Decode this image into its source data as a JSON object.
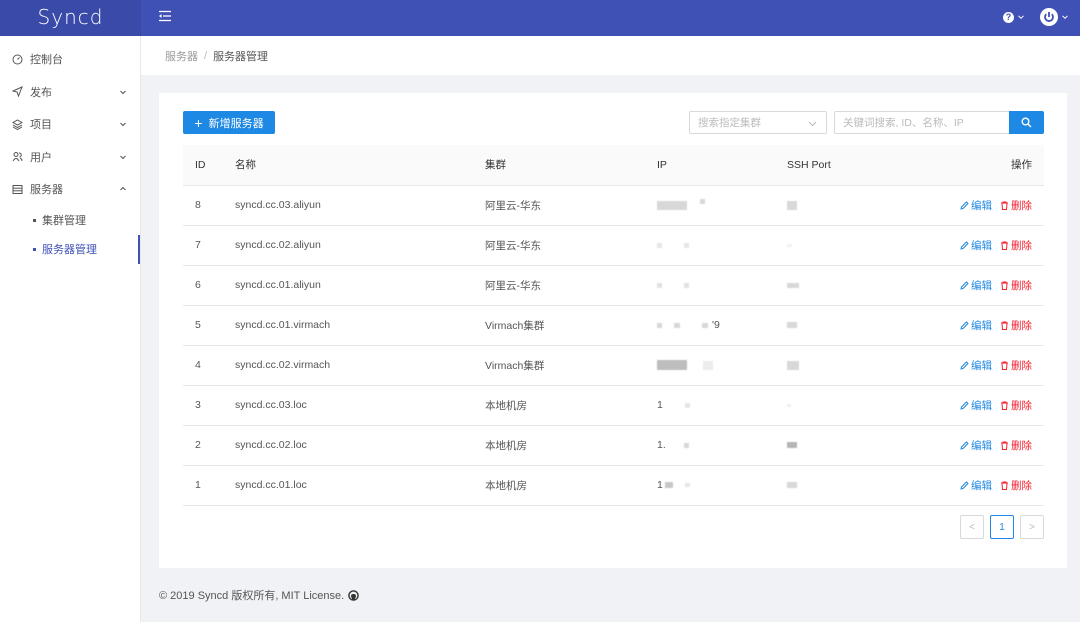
{
  "app": {
    "title": "Syncd"
  },
  "sidebar": {
    "items": [
      {
        "label": "控制台",
        "icon": "dashboard-icon"
      },
      {
        "label": "发布",
        "icon": "send-icon"
      },
      {
        "label": "项目",
        "icon": "layers-icon"
      },
      {
        "label": "用户",
        "icon": "users-icon"
      },
      {
        "label": "服务器",
        "icon": "server-icon"
      }
    ],
    "sub_items": [
      {
        "label": "集群管理"
      },
      {
        "label": "服务器管理"
      }
    ]
  },
  "breadcrumb": {
    "parent": "服务器",
    "separator": "/",
    "current": "服务器管理"
  },
  "toolbar": {
    "add_label": "新增服务器",
    "cluster_placeholder": "搜索指定集群",
    "search_placeholder": "关键词搜索, ID、名称、IP"
  },
  "table": {
    "headers": {
      "id": "ID",
      "name": "名称",
      "cluster": "集群",
      "ip": "IP",
      "ssh": "SSH Port",
      "op": "操作"
    },
    "edit_label": "编辑",
    "delete_label": "删除",
    "rows": [
      {
        "id": "8",
        "name": "syncd.cc.03.aliyun",
        "cluster": "阿里云-华东",
        "ip": "",
        "ssh": ""
      },
      {
        "id": "7",
        "name": "syncd.cc.02.aliyun",
        "cluster": "阿里云-华东",
        "ip": "",
        "ssh": ""
      },
      {
        "id": "6",
        "name": "syncd.cc.01.aliyun",
        "cluster": "阿里云-华东",
        "ip": "",
        "ssh": ""
      },
      {
        "id": "5",
        "name": "syncd.cc.01.virmach",
        "cluster": "Virmach集群",
        "ip": "'9",
        "ssh": ""
      },
      {
        "id": "4",
        "name": "syncd.cc.02.virmach",
        "cluster": "Virmach集群",
        "ip": "",
        "ssh": ""
      },
      {
        "id": "3",
        "name": "syncd.cc.03.loc",
        "cluster": "本地机房",
        "ip": "1",
        "ssh": ""
      },
      {
        "id": "2",
        "name": "syncd.cc.02.loc",
        "cluster": "本地机房",
        "ip": "1.",
        "ssh": ""
      },
      {
        "id": "1",
        "name": "syncd.cc.01.loc",
        "cluster": "本地机房",
        "ip": "1",
        "ssh": ""
      }
    ]
  },
  "pagination": {
    "prev": "<",
    "current": "1",
    "next": ">"
  },
  "footer": {
    "text": "© 2019 Syncd 版权所有, MIT License."
  },
  "colors": {
    "primary": "#3f51b5",
    "accent": "#1e88e5",
    "danger": "#f5222d"
  }
}
